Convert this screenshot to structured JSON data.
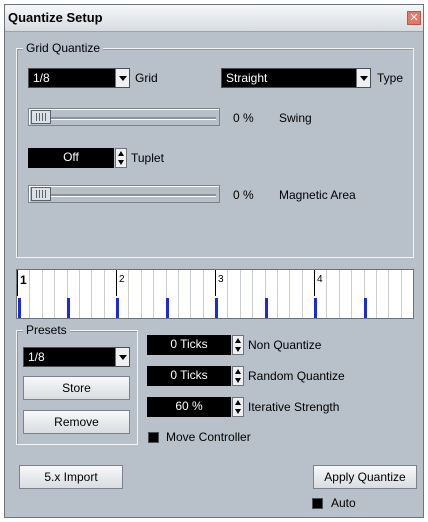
{
  "window": {
    "title": "Quantize Setup",
    "close_glyph": "✕"
  },
  "grid_quantize": {
    "group_label": "Grid Quantize",
    "grid": {
      "value": "1/8",
      "label": "Grid"
    },
    "type": {
      "value": "Straight",
      "label": "Type"
    },
    "swing": {
      "value": "0 %",
      "label": "Swing",
      "level": 0
    },
    "tuplet": {
      "value": "Off",
      "label": "Tuplet"
    },
    "magnetic": {
      "value": "0 %",
      "label": "Magnetic Area",
      "level": 0
    }
  },
  "ruler": {
    "bar_numbers": [
      "1",
      "2",
      "3",
      "4"
    ],
    "tick_color": "#1a2bdc"
  },
  "presets": {
    "group_label": "Presets",
    "value": "1/8",
    "store_label": "Store",
    "remove_label": "Remove"
  },
  "fields": {
    "non_quantize": {
      "value": "0 Ticks",
      "label": "Non Quantize"
    },
    "random_quantize": {
      "value": "0 Ticks",
      "label": "Random Quantize"
    },
    "iterative_strength": {
      "value": "60 %",
      "label": "Iterative Strength"
    },
    "move_controller": {
      "label": "Move Controller",
      "checked": true
    }
  },
  "bottom": {
    "import_label": "5.x Import",
    "apply_label": "Apply Quantize",
    "auto_label": "Auto",
    "auto_checked": true
  }
}
